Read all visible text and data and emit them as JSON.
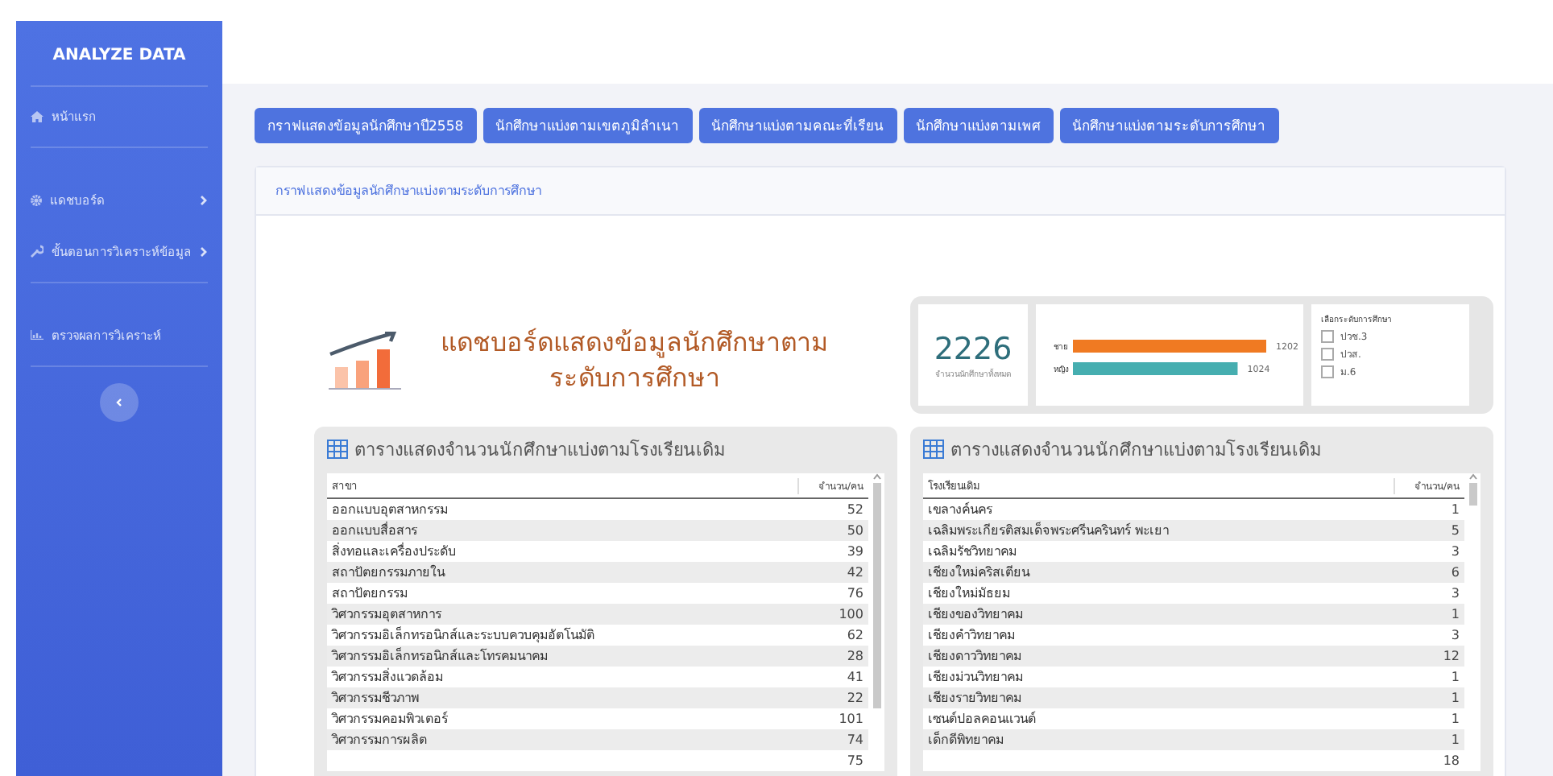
{
  "sidebar": {
    "brand": "ANALYZE DATA",
    "items": [
      {
        "label": "หน้าแรก",
        "has_submenu": false,
        "divider_after": true
      },
      {
        "label": "แดชบอร์ด",
        "has_submenu": true,
        "divider_after": false
      },
      {
        "label": "ขั้นตอนการวิเคราะห์ข้อมูล",
        "has_submenu": true,
        "divider_after": true
      },
      {
        "label": "ตรวจผลการวิเคราะห์",
        "has_submenu": false,
        "divider_after": true
      }
    ]
  },
  "nav_buttons": [
    "กราฟแสดงข้อมูลนักศึกษาปี2558",
    "นักศึกษาแบ่งตามเขตภูมิลำเนา",
    "นักศึกษาแบ่งตามคณะที่เรียน",
    "นักศึกษาแบ่งตามเพศ",
    "นักศึกษาแบ่งตามระดับการศึกษา"
  ],
  "card": {
    "title": "กราฟแสดงข้อมูลนักศึกษาแบ่งตามระดับการศึกษา",
    "dashboard_title": "แดชบอร์ดแสดงข้อมูลนักศึกษาตามระดับการศึกษา",
    "kpi": {
      "value": "2226",
      "label": "จำนวนนักศึกษาทั้งหมด"
    },
    "gender_chart": {
      "chart_data": {
        "type": "bar",
        "orientation": "horizontal",
        "stacked": true,
        "series": [
          {
            "name": "ชาย",
            "color": "#f07a22",
            "values": [
              1202,
              null
            ]
          },
          {
            "name": "หญิง",
            "color": "#46aeb0",
            "values": [
              null,
              1024
            ]
          }
        ],
        "data_labels": true
      }
    },
    "filter": {
      "title": "เลือกระดับการศึกษา",
      "options": [
        {
          "label": "ปวช.3",
          "checked": false
        },
        {
          "label": "ปวส.",
          "checked": false
        },
        {
          "label": "ม.6",
          "checked": false
        }
      ]
    },
    "tables": [
      {
        "title": "ตารางแสดงจำนวนนักศึกษาแบ่งตามโรงเรียนเดิม",
        "columns": [
          "สาขา",
          "จำนวน/คน"
        ],
        "rows": [
          {
            "name": "ออกแบบอุตสาหกรรม",
            "value": "52"
          },
          {
            "name": "ออกแบบสื่อสาร",
            "value": "50"
          },
          {
            "name": "สิ่งทอและเครื่องประดับ",
            "value": "39"
          },
          {
            "name": "สถาปัตยกรรมภายใน",
            "value": "42"
          },
          {
            "name": "สถาปัตยกรรม",
            "value": "76"
          },
          {
            "name": "วิศวกรรมอุตสาหการ",
            "value": "100"
          },
          {
            "name": "วิศวกรรมอิเล็กทรอนิกส์และระบบควบคุมอัตโนมัติ",
            "value": "62"
          },
          {
            "name": "วิศวกรรมอิเล็กทรอนิกส์และโทรคมนาคม",
            "value": "28"
          },
          {
            "name": "วิศวกรรมสิ่งแวดล้อม",
            "value": "41"
          },
          {
            "name": "วิศวกรรมชีวภาพ",
            "value": "22"
          },
          {
            "name": "วิศวกรรมคอมพิวเตอร์",
            "value": "101"
          },
          {
            "name": "วิศวกรรมการผลิต",
            "value": "74"
          },
          {
            "value": "75"
          }
        ]
      },
      {
        "title": "ตารางแสดงจำนวนนักศึกษาแบ่งตามโรงเรียนเดิม",
        "columns": [
          "โรงเรียนเดิม",
          "จำนวน/คน"
        ],
        "rows": [
          {
            "name": "เขลางค์นคร",
            "value": "1"
          },
          {
            "name": "เฉลิมพระเกียรติสมเด็จพระศรีนครินทร์ พะเยา",
            "value": "5"
          },
          {
            "name": "เฉลิมรัชวิทยาคม",
            "value": "3"
          },
          {
            "name": "เชียงใหม่คริสเตียน",
            "value": "6"
          },
          {
            "name": "เชียงใหม่มัธยม",
            "value": "3"
          },
          {
            "name": "เชียงของวิทยาคม",
            "value": "1"
          },
          {
            "name": "เชียงคำวิทยาคม",
            "value": "3"
          },
          {
            "name": "เชียงดาววิทยาคม",
            "value": "12"
          },
          {
            "name": "เชียงม่วนวิทยาคม",
            "value": "1"
          },
          {
            "name": "เชียงรายวิทยาคม",
            "value": "1"
          },
          {
            "name": "เซนต์ปอลคอนแวนต์",
            "value": "1"
          },
          {
            "name": "เด็กดีพิทยาคม",
            "value": "1"
          },
          {
            "value": "18"
          }
        ]
      }
    ]
  }
}
